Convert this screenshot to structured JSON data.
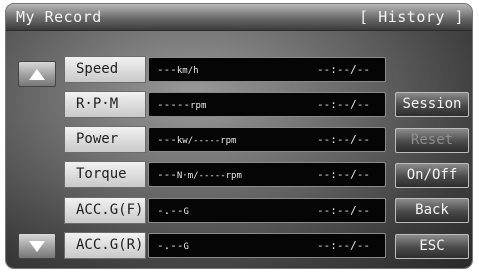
{
  "header": {
    "title": "My Record",
    "mode": "[ History ]"
  },
  "nav": {
    "up_icon": "triangle-up",
    "down_icon": "triangle-down"
  },
  "rows": [
    {
      "label": "Speed",
      "value": "---",
      "unit": "km/h",
      "time": "--:--/--"
    },
    {
      "label": "R·P·M",
      "value": "-----",
      "unit": "rpm",
      "time": "--:--/--"
    },
    {
      "label": "Power",
      "value": "---",
      "unit": "kw/-----rpm",
      "time": "--:--/--"
    },
    {
      "label": "Torque",
      "value": "---",
      "unit": "N·m/-----rpm",
      "time": "--:--/--"
    },
    {
      "label": "ACC.G(F)",
      "value": "-.--",
      "unit": "G",
      "time": "--:--/--"
    },
    {
      "label": "ACC.G(R)",
      "value": "-.--",
      "unit": "G",
      "time": "--:--/--"
    }
  ],
  "buttons": {
    "session": "Session",
    "reset": "Reset",
    "onoff": "On/Off",
    "back": "Back",
    "esc": "ESC"
  }
}
